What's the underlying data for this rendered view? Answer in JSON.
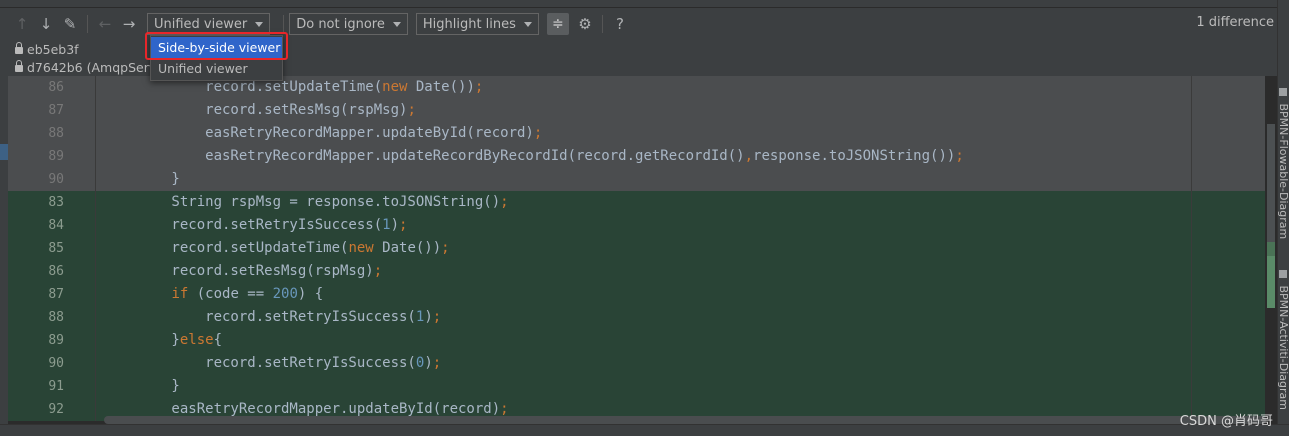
{
  "toolbar": {
    "icons": [
      "arrow-up-icon",
      "arrow-down-icon",
      "edit-icon",
      "arrow-left-icon",
      "arrow-right-icon"
    ],
    "viewer_combo": "Unified viewer",
    "ignore_combo": "Do not ignore",
    "highlight_combo": "Highlight lines",
    "help_label": "?",
    "difference_count": "1 difference"
  },
  "revisions": {
    "first": "eb5eb3f",
    "second": "d7642b6 (AmqpServi"
  },
  "dropdown": {
    "options": [
      "Side-by-side viewer",
      "Unified viewer"
    ],
    "selected": "Side-by-side viewer"
  },
  "code_lines": [
    {
      "num": "86",
      "kind": "old",
      "indent": "            ",
      "text": "record.setUpdateTime(new Date());"
    },
    {
      "num": "87",
      "kind": "old",
      "indent": "            ",
      "text": "record.setResMsg(rspMsg);"
    },
    {
      "num": "88",
      "kind": "old",
      "indent": "            ",
      "text": "easRetryRecordMapper.updateById(record);"
    },
    {
      "num": "89",
      "kind": "old",
      "indent": "            ",
      "text": "easRetryRecordMapper.updateRecordByRecordId(record.getRecordId(),response.toJSONString());"
    },
    {
      "num": "90",
      "kind": "old",
      "indent": "        ",
      "text": "}"
    },
    {
      "num": "83",
      "kind": "new",
      "indent": "        ",
      "text": "String rspMsg = response.toJSONString();"
    },
    {
      "num": "84",
      "kind": "new",
      "indent": "        ",
      "text": "record.setRetryIsSuccess(1);"
    },
    {
      "num": "85",
      "kind": "new",
      "indent": "        ",
      "text": "record.setUpdateTime(new Date());"
    },
    {
      "num": "86",
      "kind": "new",
      "indent": "        ",
      "text": "record.setResMsg(rspMsg);"
    },
    {
      "num": "87",
      "kind": "new",
      "indent": "        ",
      "text": "if (code == 200) {"
    },
    {
      "num": "88",
      "kind": "new",
      "indent": "            ",
      "text": "record.setRetryIsSuccess(1);"
    },
    {
      "num": "89",
      "kind": "new",
      "indent": "        ",
      "text": "}else{"
    },
    {
      "num": "90",
      "kind": "new",
      "indent": "            ",
      "text": "record.setRetryIsSuccess(0);"
    },
    {
      "num": "91",
      "kind": "new",
      "indent": "        ",
      "text": "}"
    },
    {
      "num": "92",
      "kind": "new",
      "indent": "        ",
      "text": "easRetryRecordMapper.updateById(record);"
    }
  ],
  "side_tabs": [
    "BPMN-Flowable-Diagram",
    "BPMN-Activiti-Diagram"
  ],
  "watermark": "CSDN @肖码哥",
  "colors": {
    "old_line_bg": "#4b4d4f",
    "new_line_bg": "#294436",
    "keyword": "#cc7832",
    "number": "#6897bb",
    "selection": "#2f65ca",
    "highlight_border": "#e8262a"
  }
}
